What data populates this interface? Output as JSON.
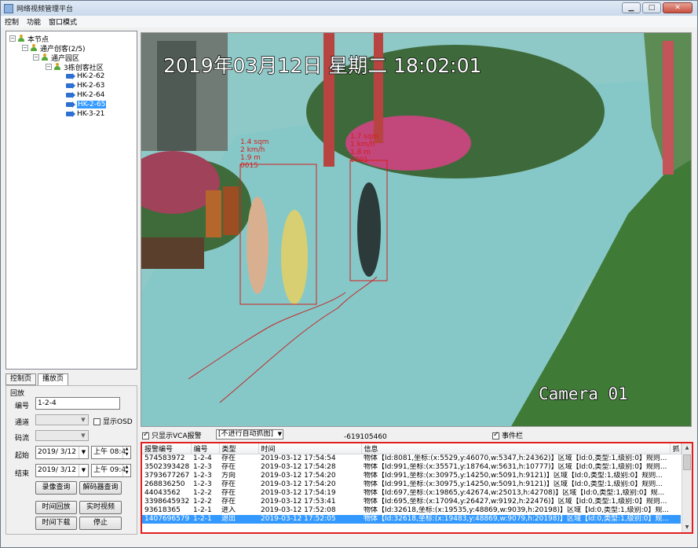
{
  "window": {
    "title": "网络视频管理平台",
    "min_glyph": "▁",
    "max_glyph": "□",
    "close_glyph": "✕"
  },
  "menu": [
    "控制",
    "功能",
    "窗口模式"
  ],
  "tree": {
    "root": "本节点",
    "level1": "通产创客(2/5)",
    "level2": "通产园区",
    "level3": "3栋创客社区",
    "cameras": [
      "HK-2-62",
      "HK-2-63",
      "HK-2-64",
      "HK-2-65",
      "HK-3-21"
    ],
    "selected_index": 3
  },
  "tabs": [
    "控制页",
    "播放页"
  ],
  "playback": {
    "group_label": "回放",
    "id_label": "编号",
    "id_value": "1-2-4",
    "channel_label": "通道",
    "show_osd_label": "显示OSD",
    "stream_label": "码流",
    "start_label": "起始",
    "start_date": "2019/ 3/12",
    "start_time": "上午 08:4",
    "end_label": "结束",
    "end_date": "2019/ 3/12",
    "end_time": "上午 09:4",
    "buttons": {
      "record_query": "录像查询",
      "decoder_query": "解码器查询",
      "time_playback": "时间回放",
      "live_video": "实时视频",
      "time_download": "时间下载",
      "stop": "停止"
    }
  },
  "video": {
    "osd_datetime": "2019年03月12日  星期二  18:02:01",
    "camera_label": "Camera 01",
    "box1_lines": [
      "1.4 sqm",
      "2 km/h",
      "1.9 m",
      "0015"
    ],
    "box2_lines": [
      "1.7 sqm",
      "1 km/h",
      "1.8 m",
      "0001"
    ],
    "colors": {
      "box": "#d32020",
      "osd_text": "#ffffff",
      "floor": "#7fc4c4"
    }
  },
  "vca_bar": {
    "show_vca_only": "只显示VCA报警",
    "capture_mode": "[不进行自动抓图]",
    "counter": "-619105460",
    "event_bar": "事件栏"
  },
  "alarm_table": {
    "columns": [
      "报警编号",
      "编号",
      "类型",
      "时间",
      "信息",
      "抓"
    ],
    "rows": [
      {
        "alarm_id": "574583972",
        "id": "1-2-4",
        "type": "存在",
        "time": "2019-03-12 17:54:54",
        "info": "物体【Id:8081,坐标:(x:5529,y:46070,w:5347,h:24362)】区域【Id:0,类型:1,级别:0】规则..."
      },
      {
        "alarm_id": "3502393428",
        "id": "1-2-3",
        "type": "存在",
        "time": "2019-03-12 17:54:28",
        "info": "物体【Id:991,坐标:(x:35571,y:18764,w:5631,h:10777)】区域【Id:0,类型:1,级别:0】规则..."
      },
      {
        "alarm_id": "3793677267",
        "id": "1-2-3",
        "type": "方向",
        "time": "2019-03-12 17:54:20",
        "info": "物体【Id:991,坐标:(x:30975,y:14250,w:5091,h:9121)】区域【Id:0,类型:1,级别:0】规则..."
      },
      {
        "alarm_id": "268836250",
        "id": "1-2-3",
        "type": "存在",
        "time": "2019-03-12 17:54:20",
        "info": "物体【Id:991,坐标:(x:30975,y:14250,w:5091,h:9121)】区域【Id:0,类型:1,级别:0】规则..."
      },
      {
        "alarm_id": "44043562",
        "id": "1-2-2",
        "type": "存在",
        "time": "2019-03-12 17:54:19",
        "info": "物体【Id:697,坐标:(x:19865,y:42674,w:25013,h:42708)】区域【Id:0,类型:1,级别:0】规..."
      },
      {
        "alarm_id": "3398645932",
        "id": "1-2-2",
        "type": "存在",
        "time": "2019-03-12 17:53:41",
        "info": "物体【Id:695,坐标:(x:17094,y:26427,w:9192,h:22476)】区域【Id:0,类型:1,级别:0】规则..."
      },
      {
        "alarm_id": "93618365",
        "id": "1-2-1",
        "type": "进入",
        "time": "2019-03-12 17:52:08",
        "info": "物体【Id:32618,坐标:(x:19535,y:48869,w:9039,h:20198)】区域【Id:0,类型:1,级别:0】规..."
      },
      {
        "alarm_id": "1407696579",
        "id": "1-2-1",
        "type": "退出",
        "time": "2019-03-12 17:52:05",
        "info": "物体【Id:32618,坐标:(x:19483,y:48869,w:9079,h:20198)】区域【Id:0,类型:1,级别:0】规..."
      }
    ],
    "selected_row": 7
  }
}
